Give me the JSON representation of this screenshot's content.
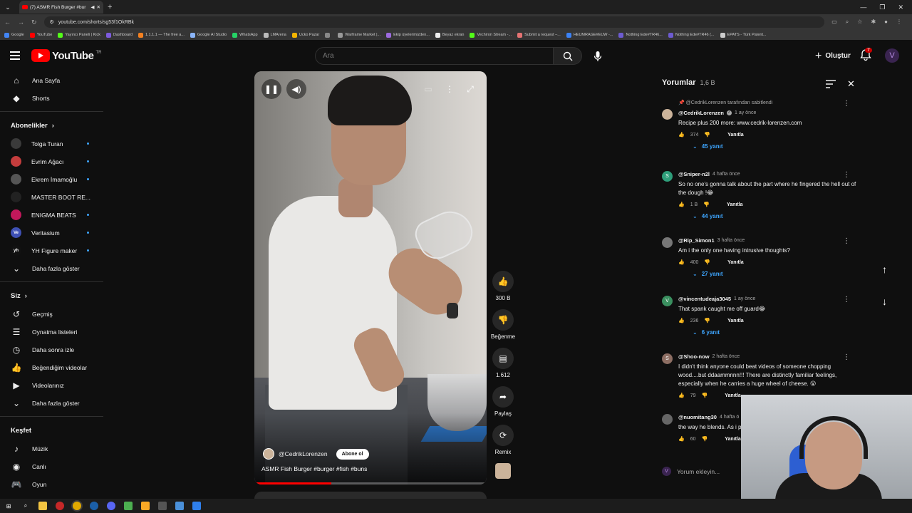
{
  "browser": {
    "tab_title": "(7) ASMR Fish Burger #bur",
    "url": "youtube.com/shorts/sg53f1OkRBk",
    "bookmarks": [
      {
        "label": "Google",
        "color": "#4285f4"
      },
      {
        "label": "YouTube",
        "color": "#ff0000"
      },
      {
        "label": "Yayıncı Paneli | Kick",
        "color": "#53fc18"
      },
      {
        "label": "Dashboard",
        "color": "#7d5bde"
      },
      {
        "label": "1.1.1.1 — The free a...",
        "color": "#f38020"
      },
      {
        "label": "Google AI Studio",
        "color": "#8ab4f8"
      },
      {
        "label": "WhatsApp",
        "color": "#25d366"
      },
      {
        "label": "LMArena",
        "color": "#bbbbbb"
      },
      {
        "label": "Ucko Pazar",
        "color": "#f4b400"
      },
      {
        "label": "",
        "color": "#888888"
      },
      {
        "label": "Warframe Market |...",
        "color": "#999999"
      },
      {
        "label": "Ekip üyelerimizden...",
        "color": "#9c6ade"
      },
      {
        "label": "Beyaz ekran",
        "color": "#eeeeee"
      },
      {
        "label": "Vechiron Stream -...",
        "color": "#53fc18"
      },
      {
        "label": "Submit a request –...",
        "color": "#e57373"
      },
      {
        "label": "HEUMRAGE#EUW -...",
        "color": "#3b82f6"
      },
      {
        "label": "Nothing Ede#TR46...",
        "color": "#6d5bd0"
      },
      {
        "label": "Nothing Ede#TR46 (...",
        "color": "#6d5bd0"
      },
      {
        "label": "EPATS - Türk Patent...",
        "color": "#cccccc"
      }
    ]
  },
  "header": {
    "logo_text": "YouTube",
    "logo_region": "TR",
    "search_placeholder": "Ara",
    "create_label": "Oluştur",
    "notification_count": "7",
    "avatar_letter": "V"
  },
  "sidebar": {
    "main": [
      {
        "label": "Ana Sayfa",
        "icon": "home-icon",
        "glyph": "⌂"
      },
      {
        "label": "Shorts",
        "icon": "shorts-icon",
        "glyph": "◆"
      }
    ],
    "subs_title": "Abonelikler",
    "subs": [
      {
        "label": "Tolga Turan",
        "color": "#3a3a3a",
        "glyph": "",
        "dot": true
      },
      {
        "label": "Evrim Ağacı",
        "color": "#c43d3d",
        "glyph": "",
        "dot": true
      },
      {
        "label": "Ekrem İmamoğlu",
        "color": "#555555",
        "glyph": "",
        "dot": true
      },
      {
        "label": "MASTER BOOT RE...",
        "color": "#222222",
        "glyph": "",
        "dot": false
      },
      {
        "label": "ENIGMA BEATS",
        "color": "#c2185b",
        "glyph": "",
        "dot": true
      },
      {
        "label": "Veritasium",
        "color": "#3f51b5",
        "glyph": "Ve",
        "dot": true
      },
      {
        "label": "YH Figure maker",
        "color": "#111111",
        "glyph": "yh",
        "dot": true
      }
    ],
    "subs_more": "Daha fazla göster",
    "you_title": "Siz",
    "you": [
      {
        "label": "Geçmiş",
        "icon": "history-icon",
        "glyph": "↺"
      },
      {
        "label": "Oynatma listeleri",
        "icon": "playlists-icon",
        "glyph": "☰"
      },
      {
        "label": "Daha sonra izle",
        "icon": "watch-later-icon",
        "glyph": "◷"
      },
      {
        "label": "Beğendiğim videolar",
        "icon": "liked-videos-icon",
        "glyph": "👍"
      },
      {
        "label": "Videolarınız",
        "icon": "your-videos-icon",
        "glyph": "▶"
      }
    ],
    "you_more": "Daha fazla göster",
    "explore_title": "Keşfet",
    "explore": [
      {
        "label": "Müzik",
        "icon": "music-icon",
        "glyph": "♪"
      },
      {
        "label": "Canlı",
        "icon": "live-icon",
        "glyph": "◉"
      },
      {
        "label": "Oyun",
        "icon": "gaming-icon",
        "glyph": "🎮"
      }
    ]
  },
  "video": {
    "channel": "@CedrikLorenzen",
    "subscribe_label": "Abone ol",
    "title": "ASMR Fish Burger #burger #fish #buns",
    "progress": 0.33
  },
  "actions": {
    "likes": "300 B",
    "dislike_label": "Beğenme",
    "comments": "1.612",
    "share_label": "Paylaş",
    "remix_label": "Remix"
  },
  "comments": {
    "title": "Yorumlar",
    "count": "1,6 B",
    "pinned_note": "@CedrikLorenzen tarafından sabitlendi",
    "items": [
      {
        "author": "@CedrikLorenzen",
        "time": "1 ay önce",
        "text": "Recipe plus 200 more: www.cedrik-lorenzen.com",
        "likes": "374",
        "replies": "45 yanıt",
        "avatar": "",
        "avatar_color": "#cbb39a"
      },
      {
        "author": "@Sniper-n2l",
        "time": "4 hafta önce",
        "text": "So no one's gonna talk about the  part where he fingered the hell out of the dough !😂",
        "likes": "1 B",
        "replies": "44 yanıt",
        "avatar": "S",
        "avatar_color": "#2e9e7a"
      },
      {
        "author": "@Rip_Simon1",
        "time": "3 hafta önce",
        "text": "Am i the only one having intrusive thoughts?",
        "likes": "400",
        "replies": "27 yanıt",
        "avatar": "",
        "avatar_color": "#777777"
      },
      {
        "author": "@vincentudeaja3045",
        "time": "1 ay önce",
        "text": "That spank caught me off guard😂",
        "likes": "236",
        "replies": "6 yanıt",
        "avatar": "V",
        "avatar_color": "#3a8f5f"
      },
      {
        "author": "@Shoo-now",
        "time": "2 hafta önce",
        "text": "I didn't think anyone could beat videos of someone chopping wood....but ddaammnnn!!!  There are distinctly familiar feelings, especially when he carries a huge wheel of cheese. 😮",
        "likes": "79",
        "replies": "",
        "avatar": "S",
        "avatar_color": "#8d6e63"
      },
      {
        "author": "@nuomitang30",
        "time": "4 hafta ö",
        "text": "the way he blends. As i possible way to put it.",
        "likes": "60",
        "replies": "",
        "avatar": "",
        "avatar_color": "#666666"
      }
    ],
    "reply_label": "Yanıtla",
    "add_placeholder": "Yorum ekleyin..."
  }
}
